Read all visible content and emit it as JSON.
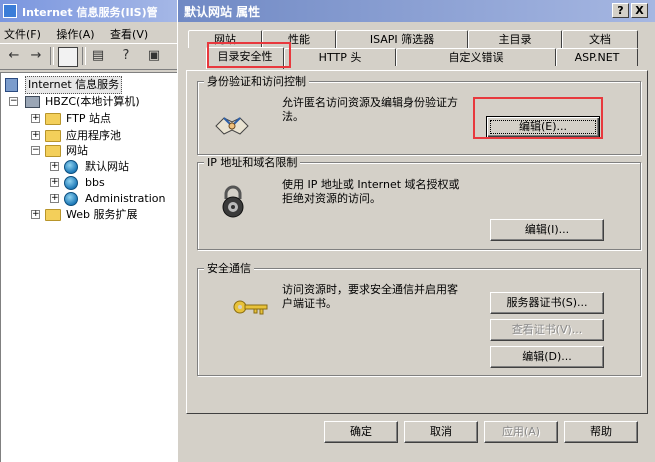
{
  "background_window": {
    "title": "Internet 信息服务(IIS)管",
    "menu": [
      "文件(F)",
      "操作(A)",
      "查看(V)"
    ],
    "toolbar_icons": [
      "back-arrow-icon",
      "forward-arrow-icon",
      "tree-view-icon",
      "properties-icon",
      "help-icon",
      "console-icon"
    ],
    "tree": {
      "root": "Internet 信息服务",
      "server": "HBZC(本地计算机)",
      "ftp": "FTP 站点",
      "app_pools": "应用程序池",
      "sites": "网站",
      "site_default": "默认网站",
      "site_bbs": "bbs",
      "site_admin": "Administration",
      "web_ext": "Web 服务扩展"
    }
  },
  "dialog": {
    "title": "默认网站 属性",
    "caption_help": "?",
    "caption_close": "X",
    "tabs_row1": [
      "网站",
      "性能",
      "ISAPI 筛选器",
      "主目录",
      "文档"
    ],
    "tabs_row2": [
      "目录安全性",
      "HTTP 头",
      "自定义错误",
      "ASP.NET"
    ],
    "active_tab": "目录安全性",
    "groups": {
      "auth": {
        "title": "身份验证和访问控制",
        "desc_line1": "允许匿名访问资源及编辑身份验证方",
        "desc_line2": "法。",
        "button": "编辑(E)..."
      },
      "ip": {
        "title": "IP 地址和域名限制",
        "desc_line1": "使用 IP 地址或 Internet 域名授权或",
        "desc_line2": "拒绝对资源的访问。",
        "button": "编辑(I)..."
      },
      "secure": {
        "title": "安全通信",
        "desc_line1": "访问资源时，要求安全通信并启用客",
        "desc_line2": "户端证书。",
        "button_cert": "服务器证书(S)...",
        "button_view": "查看证书(V)...",
        "button_edit": "编辑(D)..."
      }
    },
    "footer": {
      "ok": "确定",
      "cancel": "取消",
      "apply": "应用(A)",
      "help": "帮助"
    },
    "highlight_color": "#e8383d"
  }
}
